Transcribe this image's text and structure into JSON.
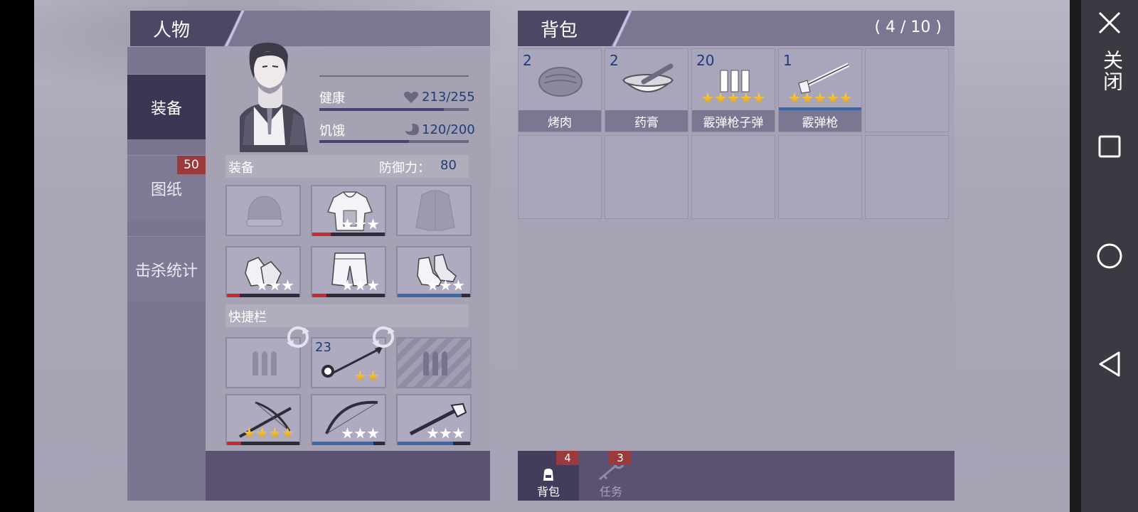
{
  "character": {
    "title": "人物",
    "side_tabs": {
      "equip": "装备",
      "blueprint": "图纸",
      "blueprint_badge": "50",
      "kills": "击杀统计"
    },
    "health_label": "健康",
    "health_value": "213/255",
    "health_fraction": 0.835,
    "hunger_label": "饥饿",
    "hunger_value": "120/200",
    "hunger_fraction": 0.6,
    "equip_section": "装备",
    "defense_label": "防御力：",
    "defense_value": "80",
    "equipment": [
      {
        "name": "beanie-hat",
        "stars": 0,
        "durability": null
      },
      {
        "name": "hoodie",
        "stars": 3,
        "star_color": "white",
        "durability": 0.25,
        "dur_color": "#c92a2f"
      },
      {
        "name": "jacket",
        "stars": 0,
        "durability": null
      },
      {
        "name": "gloves",
        "stars": 3,
        "star_color": "white",
        "durability": 0.18,
        "dur_color": "#c92a2f"
      },
      {
        "name": "shorts",
        "stars": 3,
        "star_color": "white",
        "durability": 0.2,
        "dur_color": "#c92a2f"
      },
      {
        "name": "sneakers",
        "stars": 3,
        "star_color": "white",
        "durability": 0.88,
        "dur_color": "#3a67a7"
      }
    ],
    "quickbar_section": "快捷栏",
    "quickbar": [
      {
        "name": "ammo-slot",
        "count": "",
        "stars": 0
      },
      {
        "name": "spear-weapon",
        "count": "23",
        "stars": 2,
        "star_color": "gold"
      },
      {
        "name": "locked-slot",
        "count": "",
        "stars": 0
      },
      {
        "name": "crossbow-weapon",
        "count": "",
        "stars": 4,
        "star_color": "gold",
        "durability": 0.2,
        "dur_color": "#c92a2f"
      },
      {
        "name": "bow-weapon",
        "count": "",
        "stars": 3,
        "star_color": "white",
        "durability": 0.84,
        "dur_color": "#3a67a7"
      },
      {
        "name": "wrench-weapon",
        "count": "",
        "stars": 3,
        "star_color": "white",
        "durability": 0.76,
        "dur_color": "#3a67a7"
      }
    ]
  },
  "backpack": {
    "title": "背包",
    "capacity": "( 4 / 10 )",
    "items": [
      {
        "count": "2",
        "name": "烤肉",
        "icon": "roast-meat-icon",
        "stars": 0
      },
      {
        "count": "2",
        "name": "药膏",
        "icon": "ointment-bowl-icon",
        "stars": 0
      },
      {
        "count": "20",
        "name": "霰弹枪子弹",
        "icon": "shotgun-shells-icon",
        "stars": 5
      },
      {
        "count": "1",
        "name": "霰弹枪",
        "icon": "shotgun-icon",
        "stars": 5
      }
    ],
    "tabs": [
      {
        "label": "背包",
        "badge": "4"
      },
      {
        "label": "任务",
        "badge": "3"
      }
    ]
  },
  "system_nav": {
    "close_label": "关闭"
  }
}
